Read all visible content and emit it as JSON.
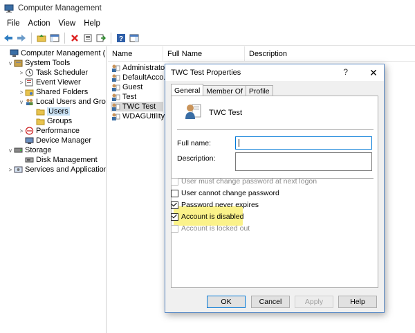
{
  "window": {
    "title": "Computer Management"
  },
  "menu": [
    "File",
    "Action",
    "View",
    "Help"
  ],
  "toolbar": {
    "icons": [
      "back-arrow-icon",
      "forward-arrow-icon",
      "up-folder-icon",
      "show-tree-icon",
      "delete-icon",
      "properties-icon",
      "export-icon",
      "help-icon",
      "console-icon"
    ]
  },
  "tree": {
    "items": [
      {
        "label": "Computer Management (Local",
        "icon": "computer-management-icon",
        "expander": ""
      },
      {
        "label": "System Tools",
        "icon": "tools-icon",
        "expander": "v"
      },
      {
        "label": "Task Scheduler",
        "icon": "clock-icon",
        "expander": ">"
      },
      {
        "label": "Event Viewer",
        "icon": "event-viewer-icon",
        "expander": ">"
      },
      {
        "label": "Shared Folders",
        "icon": "shared-folders-icon",
        "expander": ">"
      },
      {
        "label": "Local Users and Groups",
        "icon": "users-group-icon",
        "expander": "v"
      },
      {
        "label": "Users",
        "icon": "folder-icon",
        "expander": ""
      },
      {
        "label": "Groups",
        "icon": "folder-icon",
        "expander": ""
      },
      {
        "label": "Performance",
        "icon": "performance-icon",
        "expander": ">"
      },
      {
        "label": "Device Manager",
        "icon": "device-manager-icon",
        "expander": ""
      },
      {
        "label": "Storage",
        "icon": "storage-icon",
        "expander": "v"
      },
      {
        "label": "Disk Management",
        "icon": "disk-icon",
        "expander": ""
      },
      {
        "label": "Services and Applications",
        "icon": "services-icon",
        "expander": ">"
      }
    ]
  },
  "list": {
    "columns": [
      "Name",
      "Full Name",
      "Description"
    ],
    "rows": [
      "Administrator",
      "DefaultAcco...",
      "Guest",
      "Test",
      "TWC Test",
      "WDAGUtility..."
    ]
  },
  "dialog": {
    "title": "TWC Test Properties",
    "help": "?",
    "close": "✕",
    "tabs": [
      "General",
      "Member Of",
      "Profile"
    ],
    "user_name": "TWC Test",
    "full_name_label": "Full name:",
    "full_name_value": "",
    "description_label": "Description:",
    "description_value": "",
    "checkboxes": [
      {
        "label": "User must change password at next logon",
        "checked": false,
        "disabled": true
      },
      {
        "label": "User cannot change password",
        "checked": false,
        "disabled": false
      },
      {
        "label": "Password never expires",
        "checked": true,
        "disabled": false
      },
      {
        "label": "Account is disabled",
        "checked": true,
        "disabled": false
      },
      {
        "label": "Account is locked out",
        "checked": false,
        "disabled": true
      }
    ],
    "buttons": {
      "ok": "OK",
      "cancel": "Cancel",
      "apply": "Apply",
      "help": "Help"
    }
  },
  "colors": {
    "highlight": "#fbf28a",
    "accent": "#0078d7",
    "selection": "#cce4f7"
  }
}
